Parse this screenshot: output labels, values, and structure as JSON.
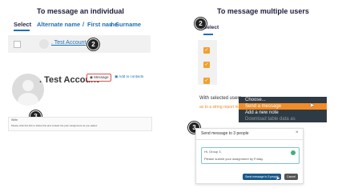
{
  "left": {
    "title": "To message an individual",
    "columns": {
      "select": "Select",
      "alternate_name": "Alternate name",
      "first_name": "First name",
      "surname": "Surname",
      "sep1": "/",
      "sep2": "/"
    },
    "row_name": ". Test Account",
    "badge_2": "2",
    "profile_name": ". Test Account",
    "message_button": "Message",
    "add_to_contacts": "Add to contacts",
    "badge_3": "3",
    "panel_label": "Write",
    "panel_text": "Please click this link to follow this and contact the prior assignment as you asked."
  },
  "right": {
    "title": "To message multiple users",
    "badge_2": "2",
    "select_label": "Select",
    "with_selected": "With selected users...",
    "link_text": "as to a string report in",
    "dropdown": {
      "options": [
        "Choose...",
        "Send a message",
        "Add a new note",
        "Download table data as"
      ]
    },
    "badge_3": "3",
    "modal": {
      "title": "Send message to 3 people",
      "message_line1": "Hi, Group 3,",
      "message_line2": "Please submit your assignment by Friday.",
      "send_button": "Send message to 3 people",
      "cancel_button": "Cancel"
    }
  },
  "colors": {
    "accent": "#1e6fb7",
    "orange": "#f28c28",
    "dark_dropdown": "#2f3b44"
  }
}
